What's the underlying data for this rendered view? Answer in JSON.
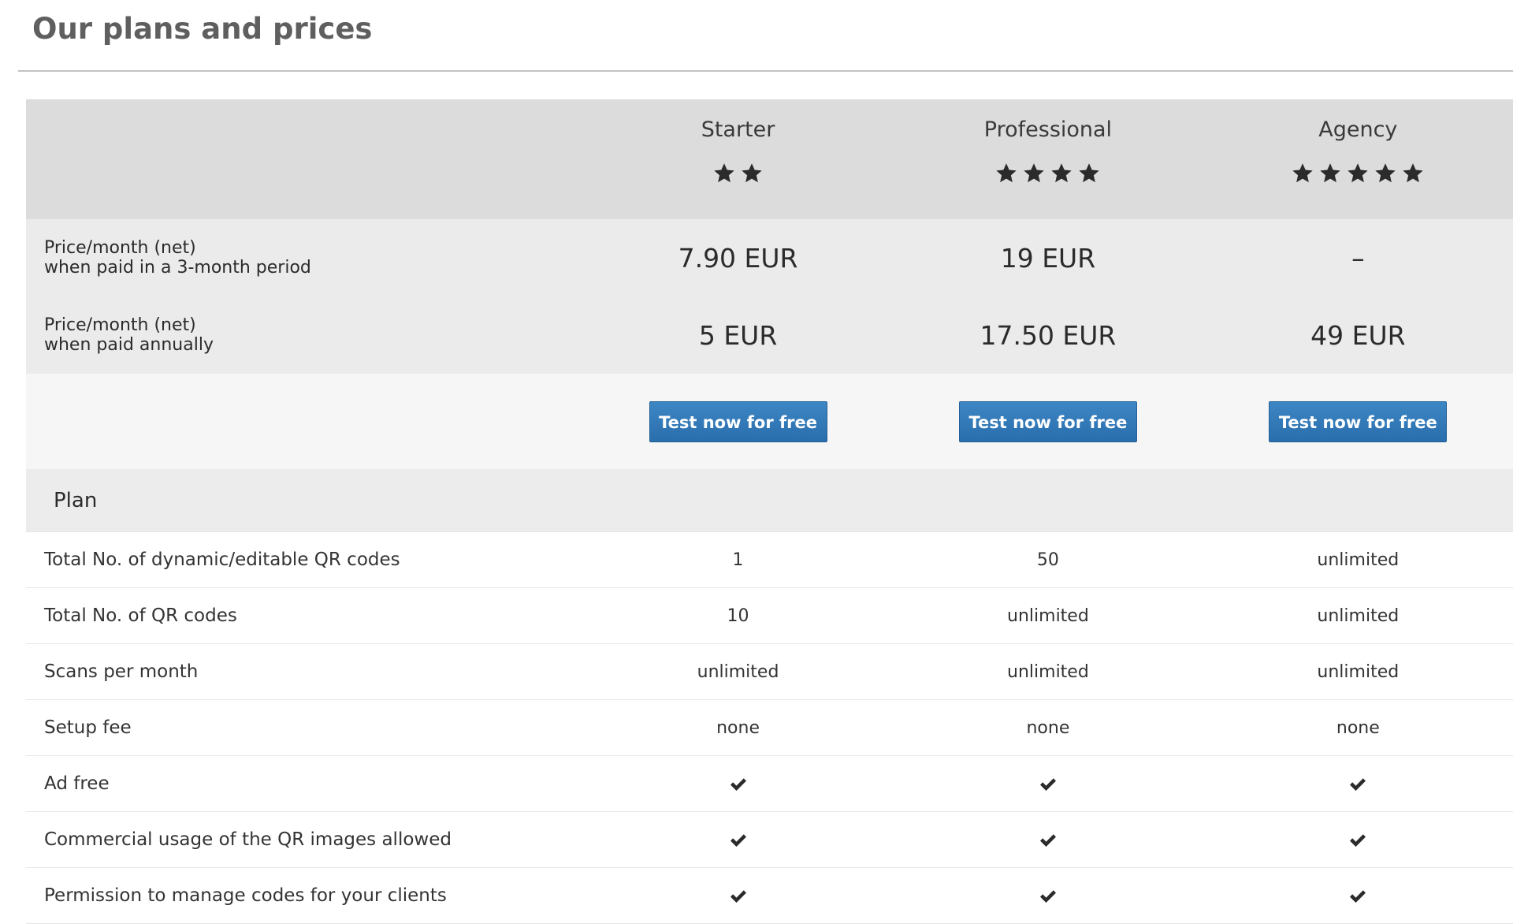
{
  "page_title": "Our plans and prices",
  "plans": [
    {
      "name": "Starter",
      "stars": 2
    },
    {
      "name": "Professional",
      "stars": 4
    },
    {
      "name": "Agency",
      "stars": 5
    }
  ],
  "price_rows": [
    {
      "label_line1": "Price/month (net)",
      "label_line2": "when paid in a 3-month period",
      "values": [
        "7.90 EUR",
        "19 EUR",
        "–"
      ]
    },
    {
      "label_line1": "Price/month (net)",
      "label_line2": "when paid annually",
      "values": [
        "5 EUR",
        "17.50 EUR",
        "49 EUR"
      ]
    }
  ],
  "cta_label": "Test now for free",
  "section_title": "Plan",
  "features": [
    {
      "label": "Total No. of dynamic/editable QR codes",
      "values": [
        "1",
        "50",
        "unlimited"
      ]
    },
    {
      "label": "Total No. of QR codes",
      "values": [
        "10",
        "unlimited",
        "unlimited"
      ]
    },
    {
      "label": "Scans per month",
      "values": [
        "unlimited",
        "unlimited",
        "unlimited"
      ]
    },
    {
      "label": "Setup fee",
      "values": [
        "none",
        "none",
        "none"
      ]
    },
    {
      "label": "Ad free",
      "values": [
        true,
        true,
        true
      ]
    },
    {
      "label": "Commercial usage of the QR images allowed",
      "values": [
        true,
        true,
        true
      ]
    },
    {
      "label": "Permission to manage codes for your clients",
      "values": [
        true,
        true,
        true
      ]
    }
  ],
  "icons": {
    "star": "star-icon",
    "check": "checkmark-icon"
  },
  "colors": {
    "button": "#2f76b7",
    "header_bg": "#dcdcdc",
    "price_bg": "#ebebeb"
  }
}
